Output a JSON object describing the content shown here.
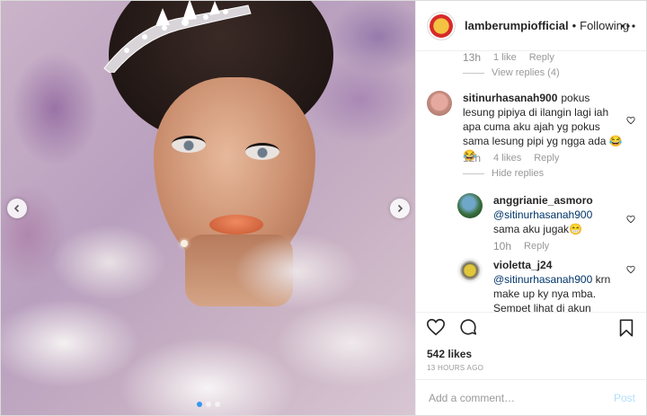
{
  "post": {
    "username": "lamberumpiofficial",
    "separator": "•",
    "follow_status": "Following",
    "likes": "542 likes",
    "time_ago": "13 HOURS AGO",
    "add_comment_placeholder": "Add a comment…",
    "post_label": "Post",
    "carousel": {
      "count": 3,
      "active": 0
    }
  },
  "comments": [
    {
      "time": "13h",
      "likes": "1 like",
      "reply_label": "Reply",
      "replies_toggle": "View replies (4)"
    },
    {
      "username": "sitinurhasanah900",
      "text": "pokus lesung pipiya di ilangin lagi iah apa cuma aku ajah yg pokus sama lesung pipi yg ngga ada 😂😂",
      "time": "12h",
      "likes": "4 likes",
      "reply_label": "Reply",
      "replies_toggle": "Hide replies"
    }
  ],
  "replies": [
    {
      "username": "anggrianie_asmoro",
      "mention": "@sitinurhasanah900",
      "text": "sama aku jugak😁",
      "time": "10h",
      "reply_label": "Reply"
    },
    {
      "username": "violetta_j24",
      "mention": "@sitinurhasanah900",
      "text": "krn make up ky nya mba. Sempet lihat di akun mana gt ada video pas proses di",
      "time": "",
      "reply_label": ""
    }
  ],
  "colors": {
    "link_blue": "#3897f0",
    "mention": "#003569",
    "muted": "#999999",
    "border": "#efefef"
  },
  "icons": {
    "heart": "heart-icon",
    "comment": "comment-icon",
    "bookmark": "bookmark-icon",
    "more": "more-icon",
    "chevron_left": "chevron-left-icon",
    "chevron_right": "chevron-right-icon"
  }
}
